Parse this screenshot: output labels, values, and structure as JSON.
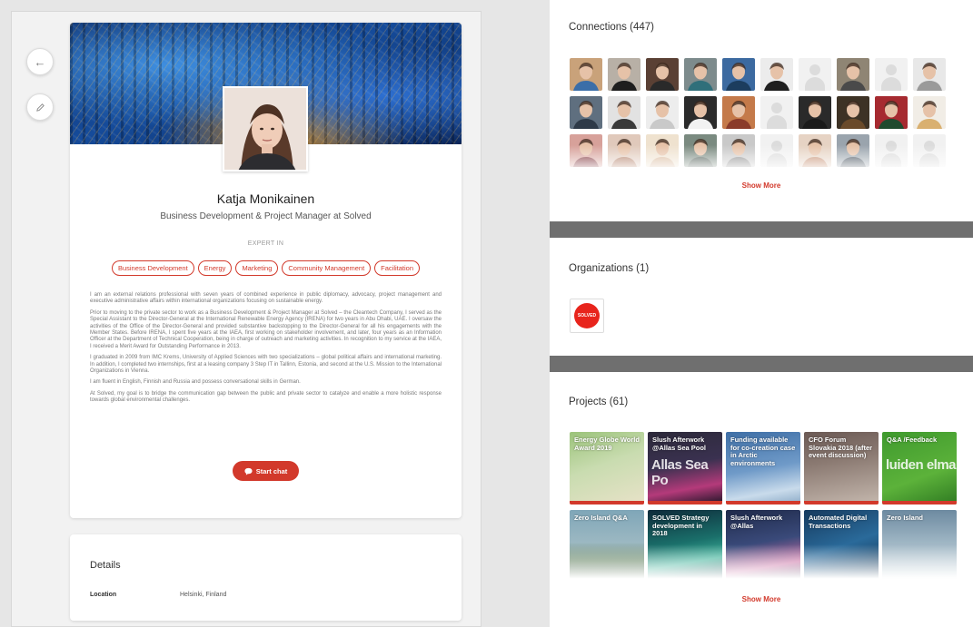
{
  "profile": {
    "name": "Katja Monikainen",
    "title": "Business Development & Project Manager at Solved",
    "expert_label": "EXPERT IN",
    "tags": [
      "Business Development",
      "Energy",
      "Marketing",
      "Community Management",
      "Facilitation"
    ],
    "bio": [
      "I am an external relations professional with seven years of combined experience in public diplomacy, advocacy, project management and executive administrative affairs within international organizations focusing on sustainable energy.",
      "Prior to moving to the private sector to work as a Business Development & Project Manager at Solved – the Cleantech Company, I served as the Special Assistant to the Director-General at the International Renewable Energy Agency (IRENA) for two years in Abu Dhabi, UAE. I oversaw the activities of the Office of the Director-General and provided substantive backstopping to the Director-General for all his engagements with the Member States. Before IRENA, I spent five years at the IAEA, first working on stakeholder involvement, and later, four years as an Information Officer at the Department of Technical Cooperation, being in charge of outreach and marketing activities. In recognition to my service at the IAEA, I received a Merit Award for Outstanding Performance in 2013.",
      "I graduated in 2009 from IMC Krems, University of Applied Sciences with two specializations – global political affairs and international marketing. In addition, I completed two internships, first at a leasing company 3 Step IT in Tallinn, Estonia, and second at the U.S. Mission to the International Organizations in Vienna.",
      "I am fluent in English, Finnish and Russia and possess conversational skills in German.",
      "At Solved, my goal is to bridge the communication gap between the public and private sector to catalyze and enable a more holistic response towards global environmental challenges."
    ],
    "chat_label": "Start chat"
  },
  "details": {
    "title": "Details",
    "location_label": "Location",
    "location_value": "Helsinki, Finland"
  },
  "connections": {
    "title": "Connections (447)",
    "show_more": "Show More",
    "avatars": [
      {
        "photo": true,
        "bg": "#c9a27a",
        "shirt": "#3b6ea8"
      },
      {
        "photo": true,
        "bg": "#b8b0a6",
        "shirt": "#1e1e1e"
      },
      {
        "photo": true,
        "bg": "#5a4034",
        "shirt": "#2a2a2a"
      },
      {
        "photo": true,
        "bg": "#7d8b8c",
        "shirt": "#2f6f7a"
      },
      {
        "photo": true,
        "bg": "#3c6aa0",
        "shirt": "#1c3d5e"
      },
      {
        "photo": true,
        "bg": "#ececec",
        "shirt": "#1f1f1f"
      },
      {
        "photo": false
      },
      {
        "photo": true,
        "bg": "#8f8574",
        "shirt": "#4a4a4a"
      },
      {
        "photo": false
      },
      {
        "photo": true,
        "bg": "#e8e8e8",
        "shirt": "#9a9a9a"
      },
      {
        "photo": true,
        "bg": "#5f6f7f",
        "shirt": "#2e3a48"
      },
      {
        "photo": true,
        "bg": "#e2e2e2",
        "shirt": "#3a3a3a"
      },
      {
        "photo": true,
        "bg": "#ededed",
        "shirt": "#c9c9c9"
      },
      {
        "photo": true,
        "bg": "#2b2b2b",
        "shirt": "#f2f2f2"
      },
      {
        "photo": true,
        "bg": "#c47a4a",
        "shirt": "#8a3b2a"
      },
      {
        "photo": false
      },
      {
        "photo": true,
        "bg": "#2a2a2a",
        "shirt": "#1a1a1a"
      },
      {
        "photo": true,
        "bg": "#3d3225",
        "shirt": "#6a4a2a"
      },
      {
        "photo": true,
        "bg": "#a62a30",
        "shirt": "#1f4a2e"
      },
      {
        "photo": true,
        "bg": "#f1ede6",
        "shirt": "#d9b070"
      },
      {
        "photo": true,
        "bg": "#d7a19a",
        "shirt": "#7a2a30"
      },
      {
        "photo": true,
        "bg": "#e0c9bb",
        "shirt": "#b07a60"
      },
      {
        "photo": true,
        "bg": "#efe2cf",
        "shirt": "#d8b89a"
      },
      {
        "photo": true,
        "bg": "#7a8a80",
        "shirt": "#4c5a52"
      },
      {
        "photo": true,
        "bg": "#c9c9c9",
        "shirt": "#8a8a8a"
      },
      {
        "photo": false
      },
      {
        "photo": true,
        "bg": "#e6d3c4",
        "shirt": "#c48a6a"
      },
      {
        "photo": true,
        "bg": "#9aa4ad",
        "shirt": "#3f4b57"
      },
      {
        "photo": false
      },
      {
        "photo": false
      }
    ]
  },
  "organizations": {
    "title": "Organizations (1)",
    "logo_text": "SOLVED"
  },
  "projects": {
    "title": "Projects (61)",
    "show_more": "Show More",
    "items": [
      {
        "title": "Energy Globe World Award 2019",
        "bg": "linear-gradient(160deg,#9bc37a 0%,#c9dcb0 45%,#e8e2c8 100%)",
        "big": ""
      },
      {
        "title": "Slush Afterwork @Allas Sea Pool",
        "bg": "linear-gradient(170deg,#2d2a3a 0%,#3a3150 45%,#b43a7a 75%,#1a1424 100%)",
        "big": "Allas Sea Po"
      },
      {
        "title": "Funding available for co-creation case in Arctic environments",
        "bg": "linear-gradient(170deg,#3f6fa6 0%,#6f9ac8 50%,#c9dbeb 80%,#8aa9c6 100%)",
        "big": ""
      },
      {
        "title": "CFO Forum Slovakia 2018 (after event discussion)",
        "bg": "linear-gradient(170deg,#6b5a55 0%,#8b7a72 40%,#c5b8ae 100%)",
        "big": ""
      },
      {
        "title": "Q&A /Feedback",
        "bg": "linear-gradient(160deg,#3f9a2e 0%,#5cb23a 60%,#2f7a22 100%)",
        "big": "luiden elma"
      },
      {
        "title": "Zero Island Q&A",
        "bg": "linear-gradient(180deg,#7fa6b8 0%,#9cb8c2 45%,#5e7f5c 70%,#3d5a3e 100%)",
        "big": ""
      },
      {
        "title": "SOLVED Strategy development in 2018",
        "bg": "linear-gradient(170deg,#0e2a3a 0%,#1a6f6a 45%,#3fb39a 70%,#123040 100%)",
        "big": ""
      },
      {
        "title": "Slush Afterwork @Allas",
        "bg": "linear-gradient(170deg,#1f2a4a 0%,#3a4a7a 45%,#c96aa0 75%,#22213a 100%)",
        "big": ""
      },
      {
        "title": "Automated Digital Transactions",
        "bg": "linear-gradient(160deg,#163a5e 0%,#2a6a9a 50%,#0f2a46 100%)",
        "big": ""
      },
      {
        "title": "Zero Island",
        "bg": "linear-gradient(180deg,#6d8aa0 0%,#9fb6c4 45%,#c9d6dc 100%)",
        "big": ""
      }
    ]
  },
  "colors": {
    "accent": "#d2392b",
    "separator": "#6f6f6f"
  },
  "icons": {
    "back": "arrow-left-icon",
    "edit": "pencil-icon",
    "chat": "chat-bubble-icon"
  }
}
